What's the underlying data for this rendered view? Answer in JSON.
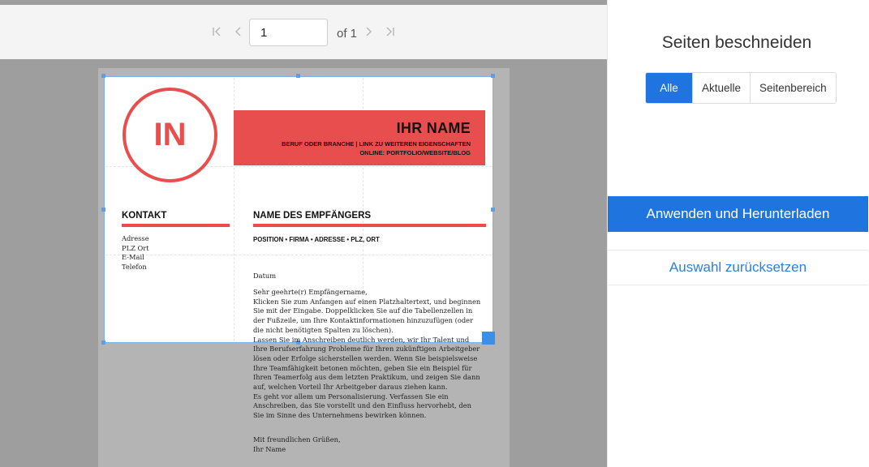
{
  "toolbar": {
    "page_value": "1",
    "page_of": "of 1"
  },
  "document": {
    "logo_initials": "IN",
    "name": "IHR NAME",
    "subtitle_line1": "BERUF ODER BRANCHE | LINK ZU WEITEREN EIGENSCHAFTEN",
    "subtitle_line2": "ONLINE: PORTFOLIO/WEBSITE/BLOG",
    "contact_heading": "KONTAKT",
    "contact_items": [
      "Adresse",
      "PLZ Ort",
      "E-Mail",
      "Telefon"
    ],
    "recipient_heading": "NAME DES EMPFÄNGERS",
    "recipient_details": "POSITION • FIRMA • ADRESSE • PLZ, ORT",
    "date": "Datum",
    "letter_lines": [
      "Sehr geehrte(r) Empfängername,",
      "Klicken Sie zum Anfangen auf einen Platzhaltertext, und beginnen",
      "Sie mit der Eingabe. Doppelklicken Sie auf die Tabellenzellen in",
      "der Fußzeile, um Ihre Kontaktinformationen hinzuzufügen (oder",
      "die nicht benötigten Spalten zu löschen).",
      "Lassen Sie im Anschreiben deutlich werden, wir Ihr Talent und",
      "Ihre Berufserfahrung Probleme für Ihren zukünftigen Arbeitgeber",
      "lösen oder Erfolge sicherstellen werden. Wenn Sie beispielsweise",
      "Ihre Teamfähigkeit betonen möchten, geben Sie ein Beispiel für",
      "Ihren Teamerfolg aus dem letzten Praktikum, und zeigen Sie dann",
      "auf, welchen Vorteil Ihr Arbeitgeber daraus ziehen kann.",
      "Es geht vor allem um Personalisierung. Verfassen Sie ein",
      "Anschreiben, das Sie vorstellt und den Einfluss hervorhebt, den",
      "Sie im Sinne des Unternehmens bewirken können."
    ],
    "closing_lines": [
      "Mit freundlichen Grüßen,",
      "Ihr Name"
    ]
  },
  "panel": {
    "title": "Seiten beschneiden",
    "segments": [
      "Alle",
      "Aktuelle",
      "Seitenbereich"
    ],
    "selected_segment": "Alle",
    "apply_label": "Anwenden und Herunterladen",
    "reset_label": "Auswahl zurücksetzen"
  },
  "colors": {
    "accent_blue": "#1f74e0",
    "doc_red": "#e84e4e",
    "crop_border": "#7fb0ea"
  },
  "icons": [
    "first-page-icon",
    "prev-page-icon",
    "next-page-icon",
    "last-page-icon"
  ]
}
